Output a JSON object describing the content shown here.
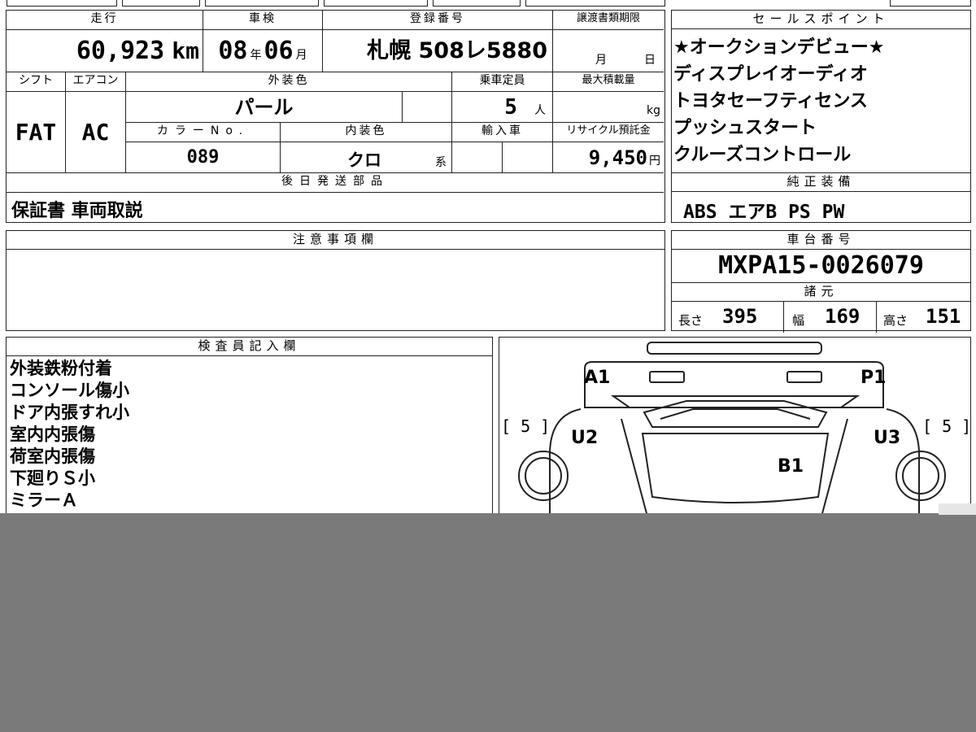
{
  "vehicle": {
    "mileage_label": "走行",
    "mileage_value": "60,923",
    "mileage_unit": "km",
    "inspection_label": "車検",
    "inspection_year": "08",
    "inspection_year_unit": "年",
    "inspection_month": "06",
    "inspection_month_unit": "月",
    "registration_label": "登録番号",
    "registration_value": "札幌 508レ5880",
    "transfer_label": "譲渡書類期限",
    "transfer_month_unit": "月",
    "transfer_day_unit": "日",
    "shift_label": "シフト",
    "shift_value": "FAT",
    "ac_label": "エアコン",
    "ac_value": "AC",
    "exterior_color_label": "外装色",
    "exterior_color_value": "パール",
    "capacity_label": "乗車定員",
    "capacity_value": "5",
    "capacity_unit": "人",
    "max_load_label": "最大積載量",
    "max_load_unit": "kg",
    "color_no_label": "カラーNo.",
    "color_no_value": "089",
    "interior_color_label": "内装色",
    "interior_color_value": "クロ",
    "interior_color_unit": "系",
    "import_label": "輸入車",
    "recycle_label": "リサイクル預託金",
    "recycle_value": "9,450",
    "recycle_unit": "円",
    "later_parts_label": "後日発送部品",
    "later_parts_value": "保証書 車両取説"
  },
  "sales_points": {
    "label": "セールスポイント",
    "lines": [
      "★オークションデビュー★",
      "ディスプレイオーディオ",
      "トヨタセーフティセンス",
      "プッシュスタート",
      "クルーズコントロール"
    ]
  },
  "genuine_equipment": {
    "label": "純正装備",
    "value": "ABS エアB PS PW"
  },
  "notes": {
    "label": "注意事項欄"
  },
  "chassis": {
    "label": "車台番号",
    "value": "MXPA15-0026079"
  },
  "specs": {
    "label": "諸元",
    "length_label": "長さ",
    "length_value": "395",
    "width_label": "幅",
    "width_value": "169",
    "height_label": "高さ",
    "height_value": "151"
  },
  "inspector": {
    "label": "検査員記入欄",
    "lines": [
      "外装鉄粉付着",
      "コンソール傷小",
      "ドア内張すれ小",
      "室内内張傷",
      "荷室内張傷",
      "下廻りＳ小",
      "ミラーＡ"
    ]
  },
  "diagram": {
    "marks": {
      "a1": "A1",
      "p1": "P1",
      "u2": "U2",
      "u3": "U3",
      "b1": "B1",
      "tire_left": "[ 5 ]",
      "tire_right": "[ 5 ]"
    }
  }
}
